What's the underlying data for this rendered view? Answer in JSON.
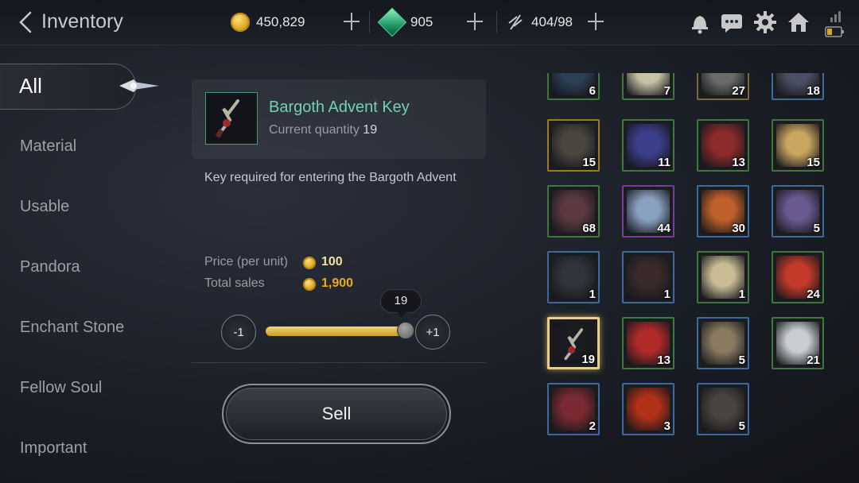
{
  "header": {
    "title": "Inventory",
    "gold": "450,829",
    "gems": "905",
    "stamina": "404/98",
    "icons": [
      "back-arrow-icon",
      "gold-coin-icon",
      "green-gem-icon",
      "stamina-icon",
      "bell-icon",
      "chat-icon",
      "gear-icon",
      "home-icon",
      "signal-icon",
      "battery-icon"
    ]
  },
  "nav": {
    "active": "All",
    "items": [
      "Material",
      "Usable",
      "Pandora",
      "Enchant Stone",
      "Fellow Soul",
      "Important"
    ]
  },
  "detail": {
    "name": "Bargoth Advent Key",
    "qty_label": "Current quantity",
    "qty": "19",
    "description": "Key required for entering the Bargoth Advent",
    "price_label": "Price (per unit)",
    "price": "100",
    "total_label": "Total sales",
    "total": "1,900",
    "slider_value": "19",
    "slider_fraction": 1.0,
    "minus_label": "-1",
    "plus_label": "+1",
    "sell_label": "Sell",
    "colors": {
      "name": "#6fd2b5",
      "price": "#f0e0a0",
      "total": "#f0a818"
    }
  },
  "grid": [
    {
      "count": "6",
      "color": "#2b3f55",
      "border": "#3b7a3b"
    },
    {
      "count": "7",
      "color": "#c9c1a6",
      "border": "#3b7a3b"
    },
    {
      "count": "27",
      "color": "#6b6c6a",
      "border": "#7a6a3a"
    },
    {
      "count": "18",
      "color": "#4b4f63",
      "border": "#3b6aa0"
    },
    {
      "count": "15",
      "color": "#4b4640",
      "border": "#a07a28"
    },
    {
      "count": "11",
      "color": "#3c3f8c",
      "border": "#3b7a3b"
    },
    {
      "count": "13",
      "color": "#8c2b2b",
      "border": "#3b7a3b"
    },
    {
      "count": "15",
      "color": "#c9a560",
      "border": "#3b7a3b"
    },
    {
      "count": "68",
      "color": "#5a3a40",
      "border": "#3b7a3b"
    },
    {
      "count": "44",
      "color": "#8aa0c0",
      "border": "#7a3aa0"
    },
    {
      "count": "30",
      "color": "#c0602a",
      "border": "#3b6aa0"
    },
    {
      "count": "5",
      "color": "#6a5a90",
      "border": "#3b6aa0"
    },
    {
      "count": "1",
      "color": "#30343c",
      "border": "#3b6aa0"
    },
    {
      "count": "1",
      "color": "#3a2a2a",
      "border": "#3b6aa0"
    },
    {
      "count": "1",
      "color": "#c9bc95",
      "border": "#3b7a3b"
    },
    {
      "count": "24",
      "color": "#c43a2a",
      "border": "#3b7a3b"
    },
    {
      "count": "19",
      "color": "#1a1c22",
      "border": "#e8cf8a",
      "selected": true
    },
    {
      "count": "13",
      "color": "#b02a2a",
      "border": "#3b7a3b"
    },
    {
      "count": "5",
      "color": "#8a7a60",
      "border": "#3b6aa0"
    },
    {
      "count": "21",
      "color": "#c7cdd0",
      "border": "#3b7a3b"
    },
    {
      "count": "2",
      "color": "#7a2a30",
      "border": "#3b6aa0"
    },
    {
      "count": "3",
      "color": "#b03018",
      "border": "#3b6aa0"
    },
    {
      "count": "5",
      "color": "#4a4440",
      "border": "#3b6aa0"
    }
  ]
}
